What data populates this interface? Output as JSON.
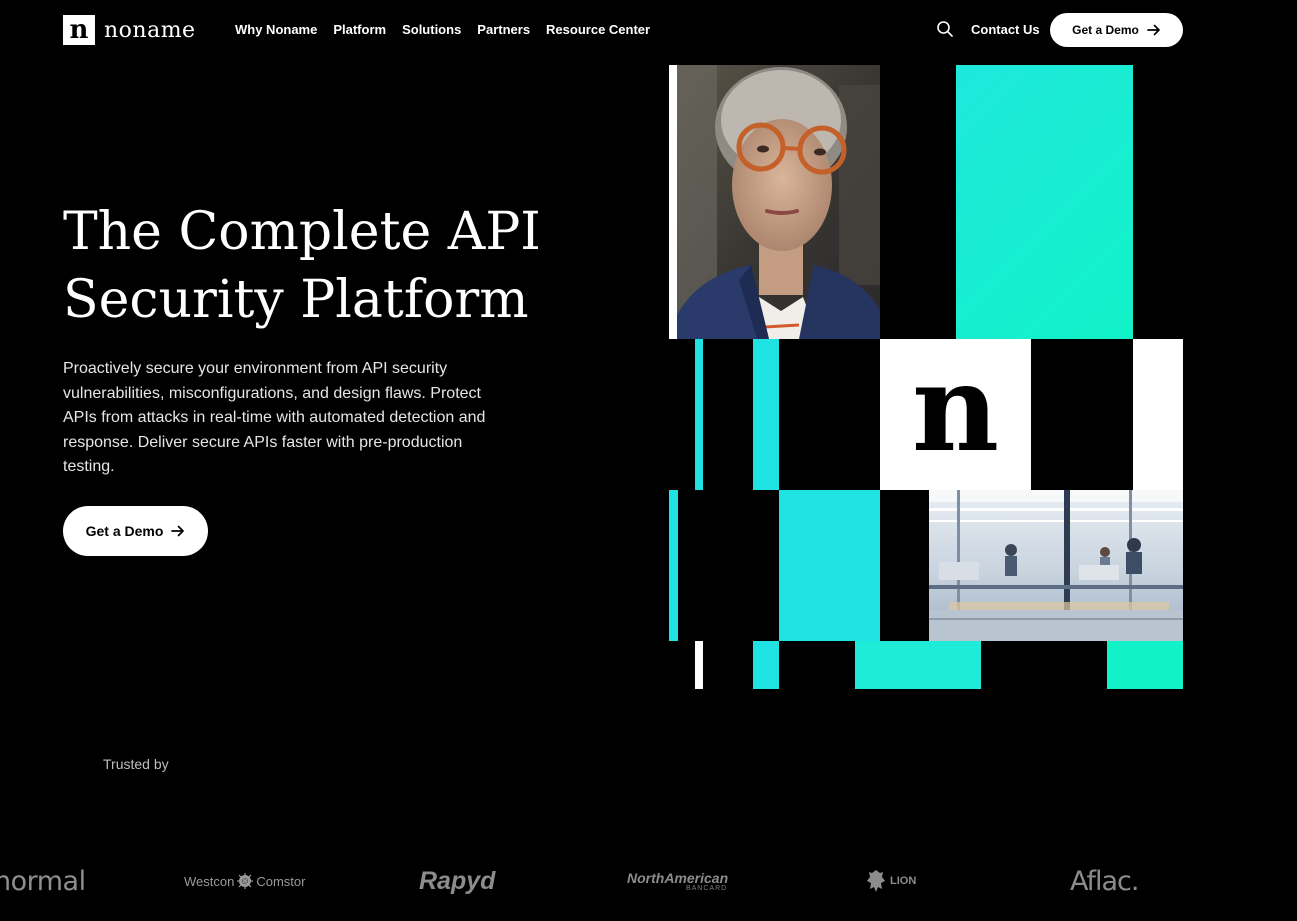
{
  "header": {
    "logo_text": "noname",
    "logo_mark": "n",
    "nav": [
      "Why Noname",
      "Platform",
      "Solutions",
      "Partners",
      "Resource Center"
    ],
    "search_icon": "search-icon",
    "contact_label": "Contact Us",
    "demo_label": "Get a Demo"
  },
  "hero": {
    "title_line1": "The Complete API",
    "title_line2": "Security Platform",
    "subtitle": "Proactively secure your environment from API security vulnerabilities, misconfigurations, and design flaws. Protect APIs from attacks in real-time with automated detection and response. Deliver secure APIs faster with pre-production testing.",
    "cta_label": "Get a Demo",
    "mosaic_mark": "n"
  },
  "trusted": {
    "label": "Trusted by",
    "logos": [
      "normal",
      "Westcon",
      "Comstor",
      "Rapyd",
      "NorthAmerican",
      "BANCARD",
      "LION",
      "Aflac."
    ]
  },
  "colors": {
    "background": "#000000",
    "text": "#ffffff",
    "accent_teal": "#1fe3d9",
    "accent_green": "#12f2c8",
    "button_bg": "#ffffff",
    "button_text": "#000000",
    "muted_logo": "#9a9a9a"
  }
}
